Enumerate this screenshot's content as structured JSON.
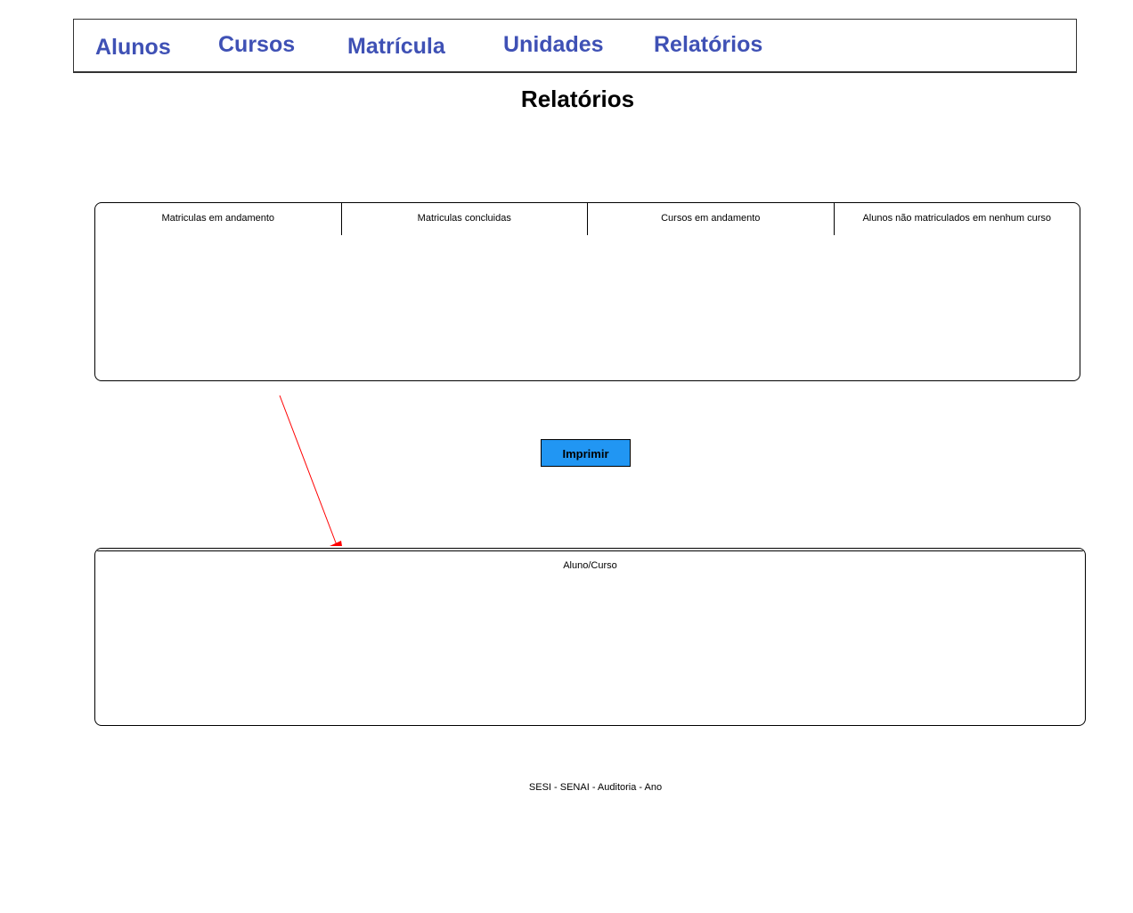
{
  "nav": {
    "items": [
      {
        "label": "Alunos"
      },
      {
        "label": "Cursos"
      },
      {
        "label": "Matrícula"
      },
      {
        "label": "Unidades"
      },
      {
        "label": "Relatórios"
      }
    ]
  },
  "page": {
    "title": "Relatórios"
  },
  "report_tabs": {
    "tabs": [
      {
        "label": "Matriculas em andamento"
      },
      {
        "label": "Matriculas concluidas"
      },
      {
        "label": "Cursos em andamento"
      },
      {
        "label": "Alunos não matriculados em nenhum curso"
      }
    ]
  },
  "actions": {
    "print_label": "Imprimir"
  },
  "result_table": {
    "header": "Aluno/Curso"
  },
  "footer": {
    "text": "SESI - SENAI - Auditoria - Ano"
  },
  "colors": {
    "nav_link": "#3f51b5",
    "print_button": "#2196f3",
    "connector_arrow": "#ff0000"
  }
}
